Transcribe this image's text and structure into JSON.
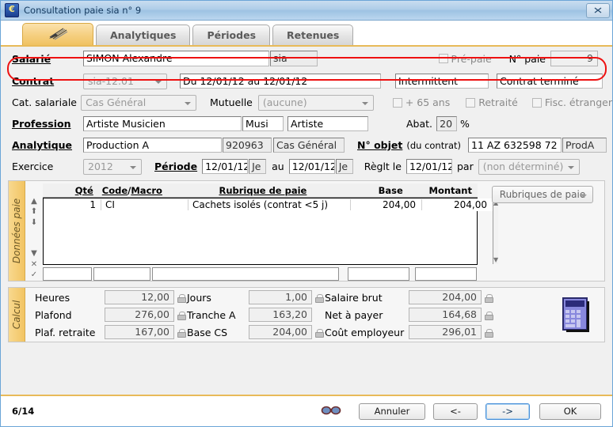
{
  "window": {
    "title": "Consultation paie sia n° 9",
    "app_icon": "euro-app-icon",
    "close_label": "✖"
  },
  "tabs": [
    {
      "label": "",
      "icon": "signature-pen-icon",
      "active": true
    },
    {
      "label": "Analytiques",
      "active": false
    },
    {
      "label": "Périodes",
      "active": false
    },
    {
      "label": "Retenues",
      "active": false
    }
  ],
  "form": {
    "salarie": {
      "label": "Salarié",
      "name_value": "SIMON Alexandre",
      "code_value": "sia",
      "prepaie_label": "Pré-paie",
      "prepaie_checked": false,
      "numpaie_label": "N° paie",
      "numpaie_value": "9"
    },
    "contrat": {
      "label": "Contrat",
      "combo_value": "sia-12.01",
      "periode_value": "Du 12/01/12 au 12/01/12",
      "type_value": "Intermittent",
      "statut_value": "Contrat terminé"
    },
    "categorie": {
      "label": "Cat. salariale",
      "combo_value": "Cas Général",
      "mutuelle_label": "Mutuelle",
      "mutuelle_value": "(aucune)",
      "plus65_label": "+ 65 ans",
      "plus65_checked": false,
      "retraite_label": "Retraité",
      "retraite_checked": false,
      "fisc_label": "Fisc. étranger",
      "fisc_checked": false
    },
    "profession": {
      "label": "Profession",
      "value": "Artiste Musicien",
      "code_value": "Musi",
      "famille_value": "Artiste",
      "abat_label": "Abat.",
      "abat_value": "20",
      "percent_label": "%"
    },
    "analytique": {
      "label": "Analytique",
      "value": "Production A",
      "code_value": "920963",
      "cas_value": "Cas Général",
      "objet_label": "N° objet",
      "objet_sub_label": "(du contrat)",
      "objet_value": "11 AZ 632598 72",
      "objet_code_value": "ProdA"
    },
    "exercice": {
      "label": "Exercice",
      "value": "2012",
      "periode_label": "Période",
      "date_from": "12/01/12",
      "day_from": "Je",
      "au_label": "au",
      "date_to": "12/01/12",
      "day_to": "Je",
      "reglt_label": "Règlt le",
      "reglt_value": "12/01/12",
      "par_label": "par",
      "mode_value": "(non déterminé)"
    }
  },
  "donnees_paie": {
    "panel_label": "Données paie",
    "nav_icons": [
      "arrow-up-icon",
      "arrow-up-top-icon",
      "arrow-down-bottom-icon",
      "arrow-down-icon",
      "delete-x-icon",
      "validate-check-icon"
    ],
    "columns": [
      "Qté",
      "Code",
      "/",
      "Macro",
      "Rubrique de paie",
      "Base",
      "Montant"
    ],
    "col_qte": "Qté",
    "col_code": "Code",
    "col_sep": "/",
    "col_macro": "Macro",
    "col_rubrique": "Rubrique de paie",
    "col_base": "Base",
    "col_montant": "Montant",
    "rows": [
      {
        "qte": "1",
        "code": "CI",
        "rubrique": "Cachets isolés (contrat <5 j)",
        "base": "204,00",
        "montant": "204,00"
      }
    ],
    "edit_row": {
      "qte": "",
      "code": "",
      "rubrique": "",
      "base": "",
      "montant": ""
    },
    "side_button": "Rubriques de paie"
  },
  "calcul": {
    "panel_label": "Calcul",
    "fields": [
      {
        "label": "Heures",
        "value": "12,00",
        "locked": true
      },
      {
        "label": "Jours",
        "value": "1,00",
        "locked": true
      },
      {
        "label": "Salaire brut",
        "value": "204,00",
        "locked": true
      },
      {
        "label": "Plafond",
        "value": "276,00",
        "locked": true
      },
      {
        "label": "Tranche A",
        "value": "163,20",
        "locked": false
      },
      {
        "label": "Net à payer",
        "value": "164,68",
        "locked": true
      },
      {
        "label": "Plaf. retraite",
        "value": "167,00",
        "locked": true
      },
      {
        "label": "Base CS",
        "value": "204,00",
        "locked": true
      },
      {
        "label": "Coût employeur",
        "value": "296,01",
        "locked": true
      }
    ],
    "calculator_icon": "calculator-icon"
  },
  "footer": {
    "page_indicator": "6/14",
    "glasses_icon": "glasses-icon",
    "buttons": [
      {
        "label": "Annuler",
        "focus": false
      },
      {
        "label": "<-",
        "focus": false
      },
      {
        "label": "->",
        "focus": true
      },
      {
        "label": "OK",
        "focus": false
      }
    ]
  },
  "colors": {
    "accent_orange": "#e8ba59",
    "highlight_red": "#ee1111",
    "title_blue": "#9dc2e3",
    "panel_tab": "#f2c463"
  }
}
